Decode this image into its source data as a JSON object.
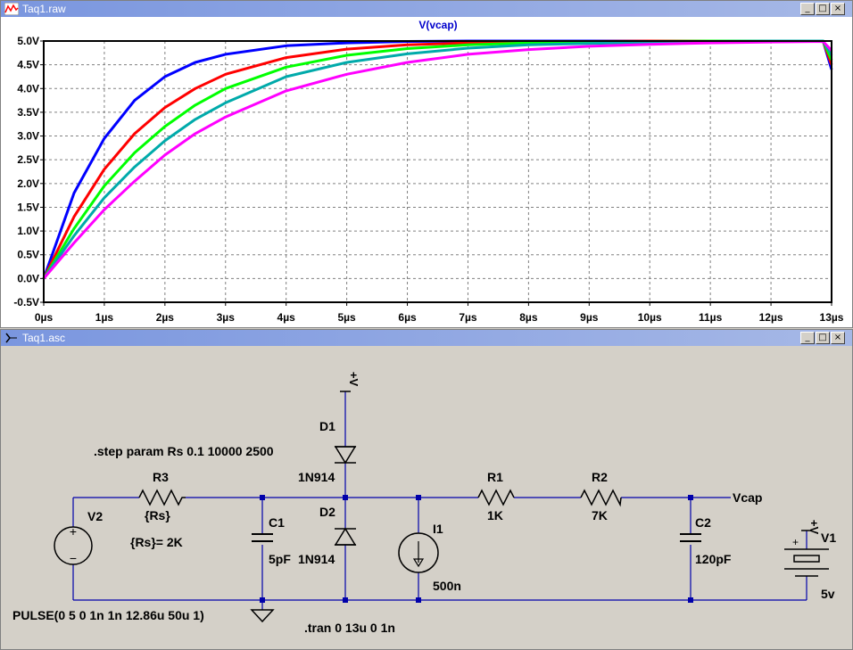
{
  "plot_window": {
    "title": "Taq1.raw",
    "controls": {
      "minimize": "_",
      "maximize": "□",
      "close": "×"
    },
    "trace_label": "V(vcap)"
  },
  "chart_data": {
    "type": "line",
    "title": "V(vcap)",
    "xlabel": "",
    "ylabel": "",
    "x_ticks": [
      "0µs",
      "1µs",
      "2µs",
      "3µs",
      "4µs",
      "5µs",
      "6µs",
      "7µs",
      "8µs",
      "9µs",
      "10µs",
      "11µs",
      "12µs",
      "13µs"
    ],
    "y_ticks": [
      "-0.5V",
      "0.0V",
      "0.5V",
      "1.0V",
      "1.5V",
      "2.0V",
      "2.5V",
      "3.0V",
      "3.5V",
      "4.0V",
      "4.5V",
      "5.0V"
    ],
    "xlim": [
      0,
      13
    ],
    "ylim": [
      -0.5,
      5.0
    ],
    "grid": true,
    "series": [
      {
        "color": "#0000ff",
        "values_x": [
          0,
          0.5,
          1,
          1.5,
          2,
          2.5,
          3,
          4,
          5,
          6,
          7,
          8,
          9,
          10,
          11,
          12,
          12.86,
          13
        ],
        "values_y": [
          0,
          1.8,
          2.95,
          3.75,
          4.25,
          4.55,
          4.72,
          4.9,
          4.96,
          4.99,
          5.0,
          5.0,
          5.0,
          5.0,
          5.0,
          5.0,
          5.0,
          4.4
        ]
      },
      {
        "color": "#ff0000",
        "values_x": [
          0,
          0.5,
          1,
          1.5,
          2,
          2.5,
          3,
          4,
          5,
          6,
          7,
          8,
          9,
          10,
          11,
          12,
          12.86,
          13
        ],
        "values_y": [
          0,
          1.3,
          2.3,
          3.05,
          3.6,
          4.0,
          4.3,
          4.65,
          4.83,
          4.92,
          4.96,
          4.98,
          4.99,
          5.0,
          5.0,
          5.0,
          5.0,
          4.5
        ]
      },
      {
        "color": "#00ff00",
        "values_x": [
          0,
          0.5,
          1,
          1.5,
          2,
          2.5,
          3,
          4,
          5,
          6,
          7,
          8,
          9,
          10,
          11,
          12,
          12.86,
          13
        ],
        "values_y": [
          0,
          1.05,
          1.95,
          2.65,
          3.2,
          3.65,
          4.0,
          4.45,
          4.7,
          4.84,
          4.92,
          4.96,
          4.98,
          4.99,
          5.0,
          5.0,
          5.0,
          4.6
        ]
      },
      {
        "color": "#00aaaa",
        "values_x": [
          0,
          0.5,
          1,
          1.5,
          2,
          2.5,
          3,
          4,
          5,
          6,
          7,
          8,
          9,
          10,
          11,
          12,
          12.86,
          13
        ],
        "values_y": [
          0,
          0.9,
          1.7,
          2.35,
          2.9,
          3.35,
          3.7,
          4.25,
          4.55,
          4.73,
          4.85,
          4.92,
          4.95,
          4.97,
          4.99,
          5.0,
          5.0,
          4.7
        ]
      },
      {
        "color": "#ff00ff",
        "values_x": [
          0,
          0.5,
          1,
          1.5,
          2,
          2.5,
          3,
          4,
          5,
          6,
          7,
          8,
          9,
          10,
          11,
          12,
          12.86,
          13
        ],
        "values_y": [
          0,
          0.75,
          1.45,
          2.05,
          2.6,
          3.05,
          3.4,
          3.95,
          4.3,
          4.55,
          4.72,
          4.82,
          4.89,
          4.93,
          4.96,
          4.98,
          4.99,
          4.8
        ]
      }
    ]
  },
  "schematic_window": {
    "title": "Taq1.asc",
    "controls": {
      "minimize": "_",
      "maximize": "□",
      "close": "×"
    }
  },
  "schematic": {
    "step_directive": ".step param Rs 0.1 10000 2500",
    "tran_directive": ".tran 0 13u 0 1n",
    "v2_name": "V2",
    "v2_value": "PULSE(0 5 0 1n 1n 12.86u 50u 1)",
    "r3_name": "R3",
    "r3_value": "{Rs}",
    "rs_label": "{Rs}= 2K",
    "c1_name": "C1",
    "c1_value": "5pF",
    "d1_name": "D1",
    "d1_value": "1N914",
    "d2_name": "D2",
    "d2_value": "1N914",
    "vplus_top": "+V",
    "i1_name": "I1",
    "i1_value": "500n",
    "r1_name": "R1",
    "r1_value": "1K",
    "r2_name": "R2",
    "r2_value": "7K",
    "c2_name": "C2",
    "c2_value": "120pF",
    "net_vcap": "Vcap",
    "v1_name": "V1",
    "v1_value": "5v",
    "vplus_v1": "+V",
    "plus_sign": "+",
    "minus_sign": "−"
  }
}
